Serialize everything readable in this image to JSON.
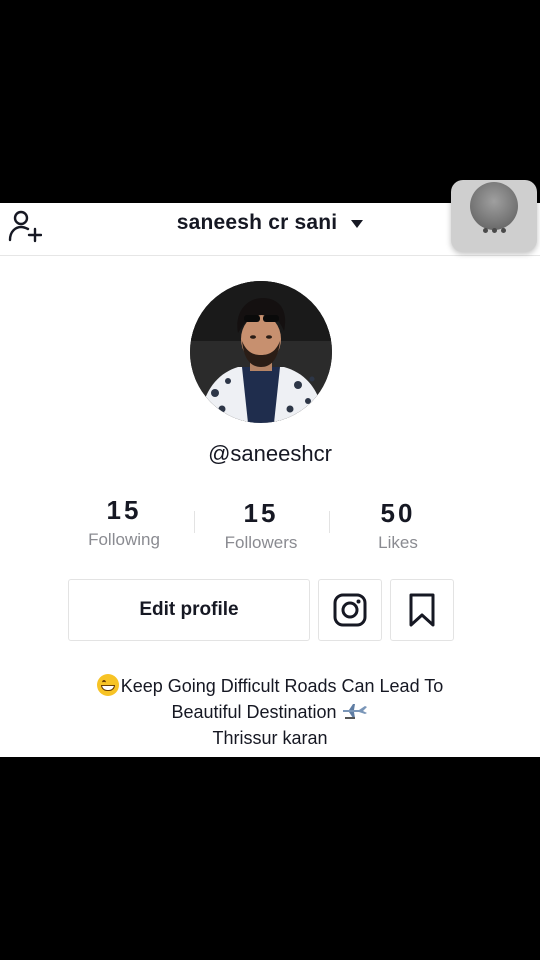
{
  "profile": {
    "display_name": "saneesh cr sani",
    "handle": "@saneeshcr",
    "stats": [
      {
        "value": "15",
        "label": "Following"
      },
      {
        "value": "15",
        "label": "Followers"
      },
      {
        "value": "50",
        "label": "Likes"
      }
    ],
    "edit_label": "Edit profile",
    "bio": {
      "line1": "Keep Going Difficult Roads Can Lead To",
      "line2": "Beautiful Destination",
      "line3": "Thrissur karan"
    }
  },
  "icons": {
    "add_user": "add-user-icon",
    "dropdown": "caret-down-icon",
    "more": "more-dots-icon",
    "instagram": "instagram-icon",
    "bookmark": "bookmark-icon",
    "bio_emoji": "grinning-face-icon",
    "bio_plane": "airplane-icon"
  },
  "colors": {
    "text_primary": "#161823",
    "text_secondary": "#8a8b91",
    "border": "#e3e3e3",
    "background": "#ffffff",
    "letterbox": "#000000"
  }
}
